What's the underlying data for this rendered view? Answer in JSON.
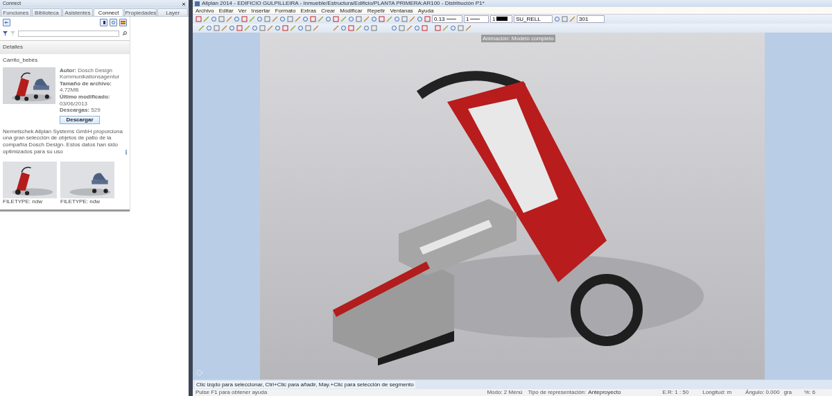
{
  "left_panel": {
    "title": "Connect",
    "tabs": [
      {
        "label": "Funciones",
        "selected": false
      },
      {
        "label": "Biblioteca",
        "selected": false
      },
      {
        "label": "Asistentes",
        "selected": false
      },
      {
        "label": "Connect",
        "selected": true
      },
      {
        "label": "Propiedades",
        "selected": false
      },
      {
        "label": "Layer",
        "selected": false
      }
    ],
    "section": "Detalles",
    "item_title": "Carrito_bebés",
    "details": [
      "**Autor:** Dosch Design Kommunikationsagentur",
      "**Tamaño de archivo:** 4.72MB",
      "**Último modificado:** 03/06/2013",
      "**Descargas:** 529"
    ],
    "download_button": "Descargar",
    "description": "Nemetschek Allplan Systems GmbH proporciona una gran selección de objetos de patio de la compañía Dosch Design. Estos datos han sido optimizados para su uso",
    "thumbnails": [
      {
        "kind": "picture",
        "caption": "FILETYPE: ndw"
      },
      {
        "kind": "picture",
        "caption": "FILETYPE: ndw"
      }
    ]
  },
  "window": {
    "title": "Allplan 2014 - EDIFICIO GULPILLEIRA - Inmueble/Estructura/Edificio/PLANTA PRIMERA:AR100 - Distribución P1*"
  },
  "menu": [
    "Archivo",
    "Editar",
    "Ver",
    "Insertar",
    "Formato",
    "Extras",
    "Crear",
    "Modificar",
    "Repetir",
    "Ventanas",
    "Ayuda"
  ],
  "toolbar": {
    "pen": "0.13",
    "line": "1",
    "color_number": "1",
    "layer": "SU_RELL",
    "pattern": "301"
  },
  "tooltip": "Animación: Modelo completo",
  "prompt": "Clic izqdo para seleccionar, Ctrl+Clic para añadir, May.+Clic para selección de segmento",
  "status_bar": {
    "help": "Pulse F1 para obtener ayuda",
    "mode": "Modo: 2 Menú",
    "representation_label": "Tipo de representación:",
    "representation": "Anteproyecto",
    "scale": "E.R: 1 : 50",
    "length": "Longitud: m",
    "angle": "Ángulo: 0.000",
    "angle_unit": "gra",
    "percent": "%: 6"
  }
}
